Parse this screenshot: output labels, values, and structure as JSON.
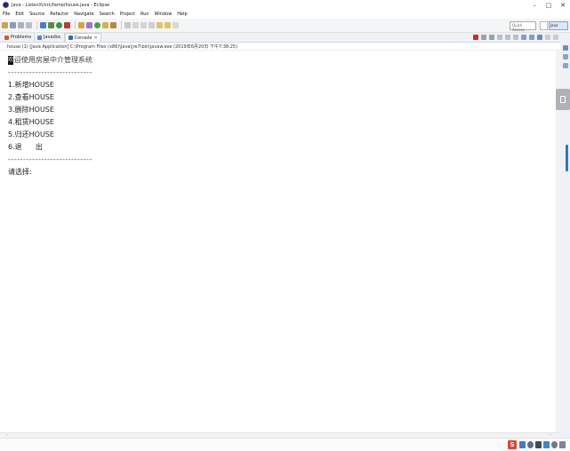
{
  "window": {
    "title": "Java - ListenXi/src/fame/house.java - Eclipse",
    "min_symbol": "–",
    "max_symbol": "□",
    "close_symbol": "✕"
  },
  "menu": [
    "File",
    "Edit",
    "Source",
    "Refactor",
    "Navigate",
    "Search",
    "Project",
    "Run",
    "Window",
    "Help"
  ],
  "toolbar": {
    "quick_access_placeholder": "Quick Access",
    "perspective_label": "Java"
  },
  "views": {
    "tabs": [
      {
        "label": "Problems",
        "close": ""
      },
      {
        "label": "Javadoc",
        "close": ""
      },
      {
        "label": "Console",
        "close": "✕"
      }
    ]
  },
  "console": {
    "header": "house (1) [Java Application] C:\\Program Files (x86)\\Java\\jre7\\bin\\javaw.exe (2019年6月20日 下午7:38:25)",
    "cursor_char": "欢",
    "welcome": "迎使用房屋中介管理系统",
    "separator_top": "----------------------------",
    "menu_items": [
      "1.新增HOUSE",
      "2.查看HOUSE",
      "3.删除HOUSE",
      "4.租赁HOUSE",
      "5.归还HOUSE",
      "6.退      出"
    ],
    "separator_bottom": "----------------------------",
    "prompt": "请选择:"
  },
  "taskbar": {
    "ime_label": "S"
  },
  "colors": {
    "toolbar_bg": "#f4f5f7",
    "view_tab_bg": "#eef1f6",
    "accent_blue": "#2b78c8",
    "ime_red": "#e8442d"
  }
}
